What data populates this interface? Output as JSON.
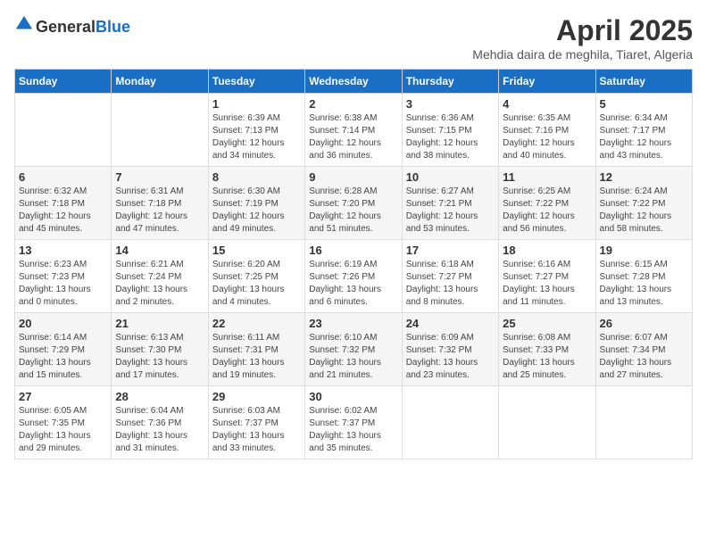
{
  "header": {
    "logo_general": "General",
    "logo_blue": "Blue",
    "title": "April 2025",
    "subtitle": "Mehdia daira de meghila, Tiaret, Algeria"
  },
  "days_of_week": [
    "Sunday",
    "Monday",
    "Tuesday",
    "Wednesday",
    "Thursday",
    "Friday",
    "Saturday"
  ],
  "weeks": [
    [
      {
        "day": "",
        "info": ""
      },
      {
        "day": "",
        "info": ""
      },
      {
        "day": "1",
        "info": "Sunrise: 6:39 AM\nSunset: 7:13 PM\nDaylight: 12 hours and 34 minutes."
      },
      {
        "day": "2",
        "info": "Sunrise: 6:38 AM\nSunset: 7:14 PM\nDaylight: 12 hours and 36 minutes."
      },
      {
        "day": "3",
        "info": "Sunrise: 6:36 AM\nSunset: 7:15 PM\nDaylight: 12 hours and 38 minutes."
      },
      {
        "day": "4",
        "info": "Sunrise: 6:35 AM\nSunset: 7:16 PM\nDaylight: 12 hours and 40 minutes."
      },
      {
        "day": "5",
        "info": "Sunrise: 6:34 AM\nSunset: 7:17 PM\nDaylight: 12 hours and 43 minutes."
      }
    ],
    [
      {
        "day": "6",
        "info": "Sunrise: 6:32 AM\nSunset: 7:18 PM\nDaylight: 12 hours and 45 minutes."
      },
      {
        "day": "7",
        "info": "Sunrise: 6:31 AM\nSunset: 7:18 PM\nDaylight: 12 hours and 47 minutes."
      },
      {
        "day": "8",
        "info": "Sunrise: 6:30 AM\nSunset: 7:19 PM\nDaylight: 12 hours and 49 minutes."
      },
      {
        "day": "9",
        "info": "Sunrise: 6:28 AM\nSunset: 7:20 PM\nDaylight: 12 hours and 51 minutes."
      },
      {
        "day": "10",
        "info": "Sunrise: 6:27 AM\nSunset: 7:21 PM\nDaylight: 12 hours and 53 minutes."
      },
      {
        "day": "11",
        "info": "Sunrise: 6:25 AM\nSunset: 7:22 PM\nDaylight: 12 hours and 56 minutes."
      },
      {
        "day": "12",
        "info": "Sunrise: 6:24 AM\nSunset: 7:22 PM\nDaylight: 12 hours and 58 minutes."
      }
    ],
    [
      {
        "day": "13",
        "info": "Sunrise: 6:23 AM\nSunset: 7:23 PM\nDaylight: 13 hours and 0 minutes."
      },
      {
        "day": "14",
        "info": "Sunrise: 6:21 AM\nSunset: 7:24 PM\nDaylight: 13 hours and 2 minutes."
      },
      {
        "day": "15",
        "info": "Sunrise: 6:20 AM\nSunset: 7:25 PM\nDaylight: 13 hours and 4 minutes."
      },
      {
        "day": "16",
        "info": "Sunrise: 6:19 AM\nSunset: 7:26 PM\nDaylight: 13 hours and 6 minutes."
      },
      {
        "day": "17",
        "info": "Sunrise: 6:18 AM\nSunset: 7:27 PM\nDaylight: 13 hours and 8 minutes."
      },
      {
        "day": "18",
        "info": "Sunrise: 6:16 AM\nSunset: 7:27 PM\nDaylight: 13 hours and 11 minutes."
      },
      {
        "day": "19",
        "info": "Sunrise: 6:15 AM\nSunset: 7:28 PM\nDaylight: 13 hours and 13 minutes."
      }
    ],
    [
      {
        "day": "20",
        "info": "Sunrise: 6:14 AM\nSunset: 7:29 PM\nDaylight: 13 hours and 15 minutes."
      },
      {
        "day": "21",
        "info": "Sunrise: 6:13 AM\nSunset: 7:30 PM\nDaylight: 13 hours and 17 minutes."
      },
      {
        "day": "22",
        "info": "Sunrise: 6:11 AM\nSunset: 7:31 PM\nDaylight: 13 hours and 19 minutes."
      },
      {
        "day": "23",
        "info": "Sunrise: 6:10 AM\nSunset: 7:32 PM\nDaylight: 13 hours and 21 minutes."
      },
      {
        "day": "24",
        "info": "Sunrise: 6:09 AM\nSunset: 7:32 PM\nDaylight: 13 hours and 23 minutes."
      },
      {
        "day": "25",
        "info": "Sunrise: 6:08 AM\nSunset: 7:33 PM\nDaylight: 13 hours and 25 minutes."
      },
      {
        "day": "26",
        "info": "Sunrise: 6:07 AM\nSunset: 7:34 PM\nDaylight: 13 hours and 27 minutes."
      }
    ],
    [
      {
        "day": "27",
        "info": "Sunrise: 6:05 AM\nSunset: 7:35 PM\nDaylight: 13 hours and 29 minutes."
      },
      {
        "day": "28",
        "info": "Sunrise: 6:04 AM\nSunset: 7:36 PM\nDaylight: 13 hours and 31 minutes."
      },
      {
        "day": "29",
        "info": "Sunrise: 6:03 AM\nSunset: 7:37 PM\nDaylight: 13 hours and 33 minutes."
      },
      {
        "day": "30",
        "info": "Sunrise: 6:02 AM\nSunset: 7:37 PM\nDaylight: 13 hours and 35 minutes."
      },
      {
        "day": "",
        "info": ""
      },
      {
        "day": "",
        "info": ""
      },
      {
        "day": "",
        "info": ""
      }
    ]
  ]
}
